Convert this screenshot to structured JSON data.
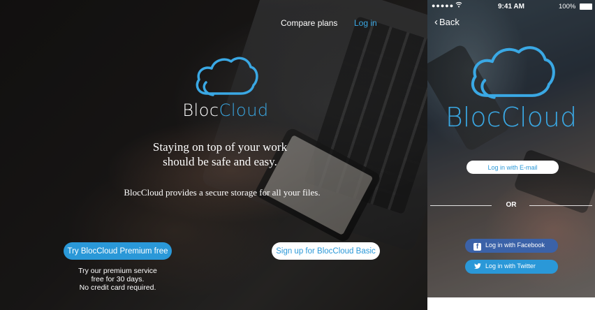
{
  "desktop": {
    "nav": {
      "compare": "Compare plans",
      "login": "Log in"
    },
    "brand": {
      "part1": "Bloc",
      "part2": "Cloud"
    },
    "headline_line1": "Staying on top of your work",
    "headline_line2": "should be safe and easy.",
    "subline": "BlocCloud provides a secure storage for all your files.",
    "premium_button": "Try BlocCloud Premium free",
    "basic_button": "Sign up for BlocCloud Basic",
    "premium_note": [
      "Try our premium service",
      "free for 30 days.",
      "No credit card required."
    ]
  },
  "mobile": {
    "status": {
      "signal": "●●●●●",
      "time": "9:41 AM",
      "battery": "100%"
    },
    "back": "Back",
    "brand": {
      "part1": "Bloc",
      "part2": "Cloud"
    },
    "email_button": "Log in with E-mail",
    "or": "OR",
    "facebook_button": "Log in with Facebook",
    "twitter_button": "Log in with Twitter"
  },
  "colors": {
    "accent": "#2a98d8",
    "facebook": "#3b62a8",
    "text_light": "#ffffff"
  },
  "icons": {
    "logo": "cloud-icon",
    "back": "chevron-left-icon",
    "wifi": "wifi-icon",
    "battery": "battery-icon",
    "facebook": "facebook-icon",
    "twitter": "twitter-icon"
  }
}
